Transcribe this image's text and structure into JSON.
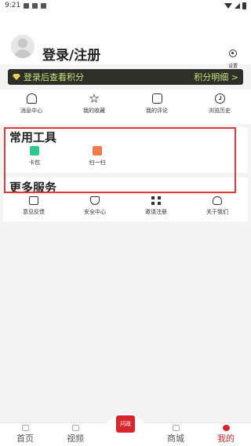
{
  "status_bar": {
    "time": "9:21",
    "icons": [
      "image-icon",
      "download-icon",
      "notification-icon"
    ],
    "right_icons": [
      "wifi-icon",
      "signal-icon",
      "battery-icon"
    ]
  },
  "profile": {
    "login_label": "登录/注册",
    "settings_label": "设置"
  },
  "points_banner": {
    "left_text": "登录后查看积分",
    "right_text": "积分明细 >",
    "text_color": "#c9e37a",
    "bg_color": "#2f2f2a"
  },
  "quick_links": [
    {
      "label": "消息中心",
      "icon": "bell-icon"
    },
    {
      "label": "我的收藏",
      "icon": "star-icon"
    },
    {
      "label": "我的评论",
      "icon": "comment-icon"
    },
    {
      "label": "浏览历史",
      "icon": "clock-icon"
    }
  ],
  "tools_section": {
    "title": "常用工具",
    "items": [
      {
        "label": "卡包",
        "icon": "card-icon",
        "color": "#2fc98a"
      },
      {
        "label": "扫一扫",
        "icon": "scan-icon",
        "color": "#f07a4d"
      }
    ]
  },
  "more_section": {
    "title": "更多服务",
    "items": [
      {
        "label": "意见反馈",
        "icon": "mail-icon"
      },
      {
        "label": "安全中心",
        "icon": "shield-icon"
      },
      {
        "label": "邀请注册",
        "icon": "grid-icon"
      },
      {
        "label": "关于我们",
        "icon": "user-settings-icon"
      }
    ]
  },
  "tab_bar": {
    "tabs": [
      {
        "label": "首页",
        "icon": "home-icon"
      },
      {
        "label": "视频",
        "icon": "video-icon"
      },
      {
        "label": "问政",
        "icon": "politics-icon"
      },
      {
        "label": "商城",
        "icon": "shop-icon"
      },
      {
        "label": "我的",
        "icon": "me-icon",
        "active": true
      }
    ],
    "active_color": "#d8262e"
  },
  "highlight_color": "#e23a36"
}
